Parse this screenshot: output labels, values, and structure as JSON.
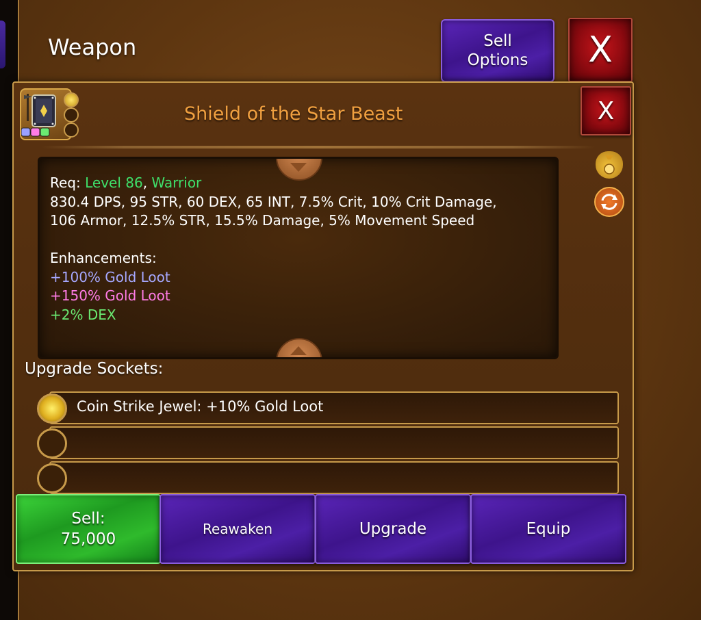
{
  "header": {
    "title": "Weapon",
    "sell_options_line1": "Sell",
    "sell_options_line2": "Options",
    "close_label": "X"
  },
  "item": {
    "name": "Shield of the Star Beast",
    "close_label": "X",
    "req_prefix": "Req: ",
    "req_level": "Level 86",
    "req_sep": ", ",
    "req_class": "Warrior",
    "stats_line1": "830.4 DPS, 95 STR, 60 DEX, 65 INT, 7.5% Crit, 10% Crit Damage,",
    "stats_line2": "106 Armor, 12.5% STR, 15.5% Damage, 5% Movement Speed",
    "enhancements_label": "Enhancements:",
    "enhancements": [
      "+100% Gold Loot",
      "+150% Gold Loot",
      "+2% DEX"
    ],
    "enhancement_colors": [
      "#a6a8ff",
      "#ff7ce6",
      "#6bea72"
    ]
  },
  "sockets": {
    "label": "Upgrade Sockets:",
    "rows": [
      "Coin Strike Jewel: +10% Gold Loot",
      "",
      ""
    ]
  },
  "actions": {
    "sell_line1": "Sell:",
    "sell_line2": "75,000",
    "reawaken": "Reawaken",
    "upgrade": "Upgrade",
    "equip": "Equip"
  },
  "colors": {
    "item_name": "#f0a040",
    "requirement_green": "#3fe06a",
    "purple_button": "#4c1fa6",
    "red_button": "#c4141a",
    "green_button": "#1e9a20"
  }
}
